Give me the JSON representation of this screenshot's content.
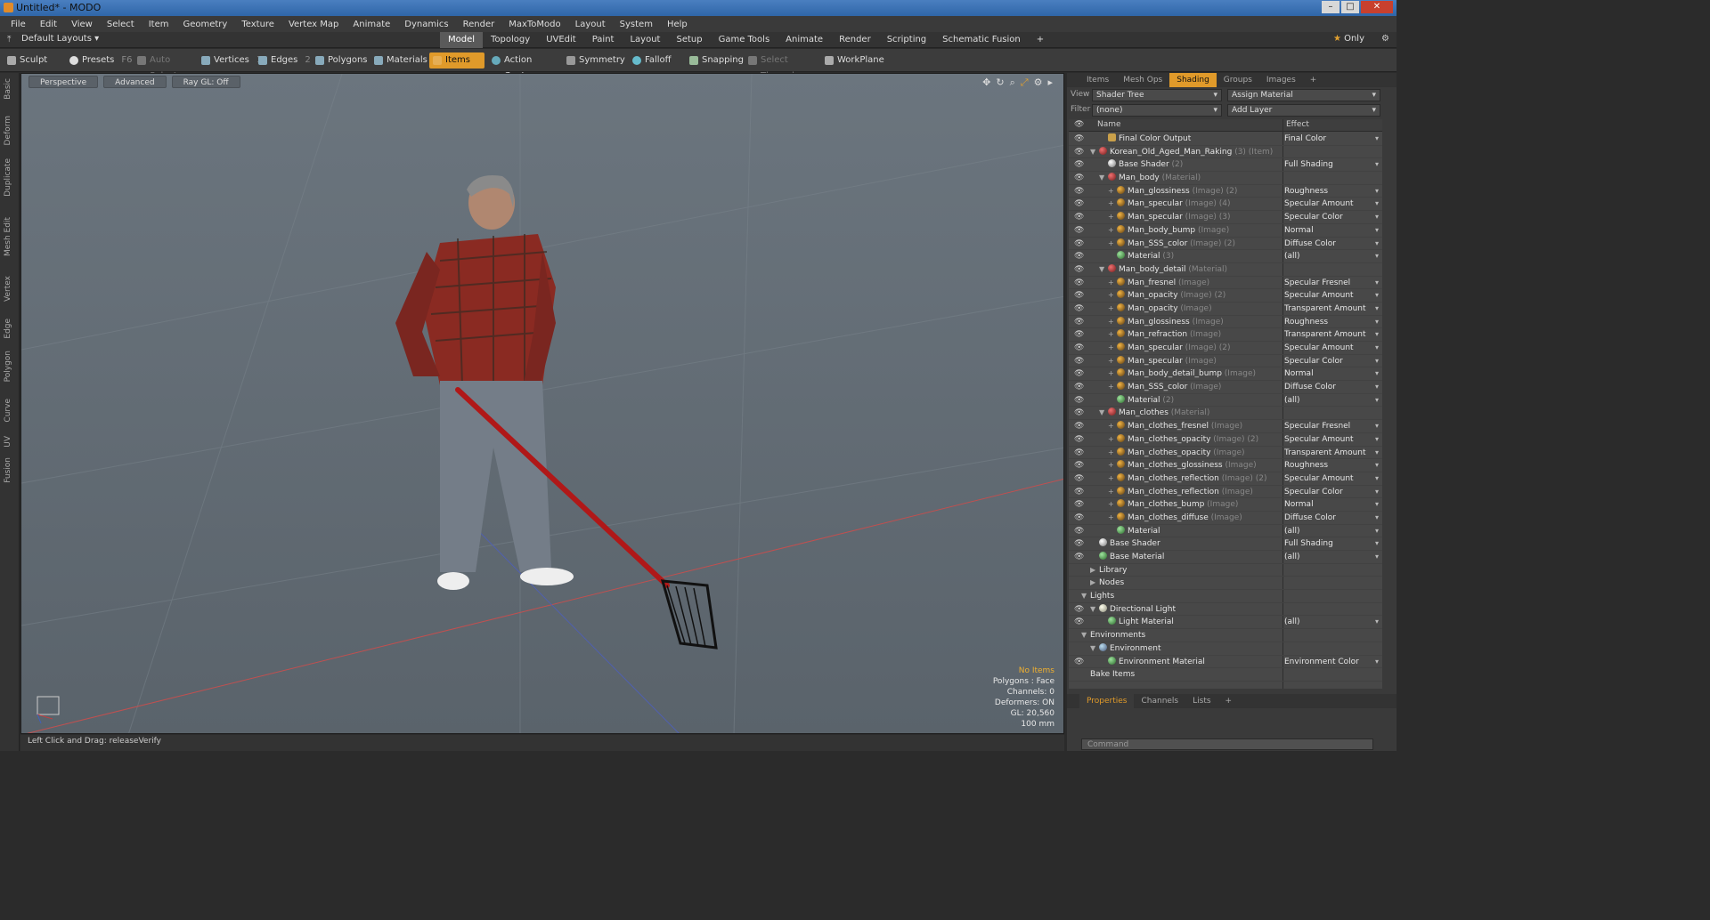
{
  "window": {
    "title": "Untitled* - MODO"
  },
  "menu": [
    "File",
    "Edit",
    "View",
    "Select",
    "Item",
    "Geometry",
    "Texture",
    "Vertex Map",
    "Animate",
    "Dynamics",
    "Render",
    "MaxToModo",
    "Layout",
    "System",
    "Help"
  ],
  "layoutbar": {
    "layouts": "Default Layouts ▾",
    "tabs": [
      "Model",
      "Topology",
      "UVEdit",
      "Paint",
      "Layout",
      "Setup",
      "Game Tools",
      "Animate",
      "Render",
      "Scripting",
      "Schematic Fusion",
      "+"
    ],
    "active_tab": "Model",
    "only": "Only"
  },
  "toolbar": {
    "sculpt": "Sculpt",
    "presets": "Presets",
    "presets_key": "F6",
    "auto_select": "Auto Select",
    "vertices": "Vertices",
    "vertices_key": "1",
    "edges": "Edges",
    "edges_key": "2",
    "polygons": "Polygons",
    "materials": "Materials",
    "items": "Items",
    "action_center": "Action Center",
    "symmetry": "Symmetry",
    "falloff": "Falloff",
    "snapping": "Snapping",
    "select_through": "Select Through",
    "workplane": "WorkPlane"
  },
  "left_strip": [
    "Basic",
    "Deform",
    "Duplicate",
    "Mesh Edit",
    "Vertex",
    "Edge",
    "Polygon",
    "Curve",
    "UV",
    "Fusion"
  ],
  "viewport": {
    "view": "Perspective",
    "mode": "Advanced",
    "raygl": "Ray GL: Off",
    "stats": {
      "no_items": "No Items",
      "polygons": "Polygons : Face",
      "channels": "Channels: 0",
      "deformers": "Deformers: ON",
      "gl": "GL: 20,560",
      "size": "100 mm"
    }
  },
  "status": {
    "text": "Left Click and Drag:  releaseVerify"
  },
  "right_panel": {
    "tabs": [
      "Items",
      "Mesh Ops",
      "Shading",
      "Groups",
      "Images",
      "+"
    ],
    "active_tab": "Shading",
    "view_label": "View",
    "view_value": "Shader Tree",
    "assign_material": "Assign Material",
    "filter_label": "Filter",
    "filter_value": "(none)",
    "add_layer": "Add Layer",
    "col_name": "Name",
    "col_effect": "Effect",
    "rows": [
      {
        "indent": 3,
        "icon": "out",
        "name": "Final Color Output",
        "type": "",
        "effect": "Final Color",
        "eye": true,
        "expand": ""
      },
      {
        "indent": 2,
        "icon": "grp",
        "name": "Korean_Old_Aged_Man_Raking",
        "type": "(3) (Item)",
        "effect": "",
        "eye": true,
        "expand": "▼"
      },
      {
        "indent": 3,
        "icon": "sh",
        "name": "Base Shader",
        "type": "(2)",
        "effect": "Full Shading",
        "eye": true,
        "expand": ""
      },
      {
        "indent": 3,
        "icon": "grp",
        "name": "Man_body",
        "type": "(Material)",
        "effect": "",
        "eye": true,
        "expand": "▼"
      },
      {
        "indent": 4,
        "icon": "img",
        "name": "Man_glossiness",
        "type": "(Image) (2)",
        "effect": "Roughness",
        "eye": true,
        "expand": "+"
      },
      {
        "indent": 4,
        "icon": "img",
        "name": "Man_specular",
        "type": "(Image) (4)",
        "effect": "Specular Amount",
        "eye": true,
        "expand": "+"
      },
      {
        "indent": 4,
        "icon": "img",
        "name": "Man_specular",
        "type": "(Image) (3)",
        "effect": "Specular Color",
        "eye": true,
        "expand": "+"
      },
      {
        "indent": 4,
        "icon": "img",
        "name": "Man_body_bump",
        "type": "(Image)",
        "effect": "Normal",
        "eye": true,
        "expand": "+"
      },
      {
        "indent": 4,
        "icon": "img",
        "name": "Man_SSS_color",
        "type": "(Image) (2)",
        "effect": "Diffuse Color",
        "eye": true,
        "expand": "+"
      },
      {
        "indent": 4,
        "icon": "mat",
        "name": "Material",
        "type": "(3)",
        "effect": "(all)",
        "eye": true,
        "expand": ""
      },
      {
        "indent": 3,
        "icon": "grp",
        "name": "Man_body_detail",
        "type": "(Material)",
        "effect": "",
        "eye": true,
        "expand": "▼"
      },
      {
        "indent": 4,
        "icon": "img",
        "name": "Man_fresnel",
        "type": "(Image)",
        "effect": "Specular Fresnel",
        "eye": true,
        "expand": "+"
      },
      {
        "indent": 4,
        "icon": "img",
        "name": "Man_opacity",
        "type": "(Image) (2)",
        "effect": "Specular Amount",
        "eye": true,
        "expand": "+"
      },
      {
        "indent": 4,
        "icon": "img",
        "name": "Man_opacity",
        "type": "(Image)",
        "effect": "Transparent Amount",
        "eye": true,
        "expand": "+"
      },
      {
        "indent": 4,
        "icon": "img",
        "name": "Man_glossiness",
        "type": "(Image)",
        "effect": "Roughness",
        "eye": true,
        "expand": "+"
      },
      {
        "indent": 4,
        "icon": "img",
        "name": "Man_refraction",
        "type": "(Image)",
        "effect": "Transparent Amount",
        "eye": true,
        "expand": "+"
      },
      {
        "indent": 4,
        "icon": "img",
        "name": "Man_specular",
        "type": "(Image) (2)",
        "effect": "Specular Amount",
        "eye": true,
        "expand": "+"
      },
      {
        "indent": 4,
        "icon": "img",
        "name": "Man_specular",
        "type": "(Image)",
        "effect": "Specular Color",
        "eye": true,
        "expand": "+"
      },
      {
        "indent": 4,
        "icon": "img",
        "name": "Man_body_detail_bump",
        "type": "(Image)",
        "effect": "Normal",
        "eye": true,
        "expand": "+"
      },
      {
        "indent": 4,
        "icon": "img",
        "name": "Man_SSS_color",
        "type": "(Image)",
        "effect": "Diffuse Color",
        "eye": true,
        "expand": "+"
      },
      {
        "indent": 4,
        "icon": "mat",
        "name": "Material",
        "type": "(2)",
        "effect": "(all)",
        "eye": true,
        "expand": ""
      },
      {
        "indent": 3,
        "icon": "grp",
        "name": "Man_clothes",
        "type": "(Material)",
        "effect": "",
        "eye": true,
        "expand": "▼"
      },
      {
        "indent": 4,
        "icon": "img",
        "name": "Man_clothes_fresnel",
        "type": "(Image)",
        "effect": "Specular Fresnel",
        "eye": true,
        "expand": "+"
      },
      {
        "indent": 4,
        "icon": "img",
        "name": "Man_clothes_opacity",
        "type": "(Image) (2)",
        "effect": "Specular Amount",
        "eye": true,
        "expand": "+"
      },
      {
        "indent": 4,
        "icon": "img",
        "name": "Man_clothes_opacity",
        "type": "(Image)",
        "effect": "Transparent Amount",
        "eye": true,
        "expand": "+"
      },
      {
        "indent": 4,
        "icon": "img",
        "name": "Man_clothes_glossiness",
        "type": "(Image)",
        "effect": "Roughness",
        "eye": true,
        "expand": "+"
      },
      {
        "indent": 4,
        "icon": "img",
        "name": "Man_clothes_reflection",
        "type": "(Image) (2)",
        "effect": "Specular Amount",
        "eye": true,
        "expand": "+"
      },
      {
        "indent": 4,
        "icon": "img",
        "name": "Man_clothes_reflection",
        "type": "(Image)",
        "effect": "Specular Color",
        "eye": true,
        "expand": "+"
      },
      {
        "indent": 4,
        "icon": "img",
        "name": "Man_clothes_bump",
        "type": "(Image)",
        "effect": "Normal",
        "eye": true,
        "expand": "+"
      },
      {
        "indent": 4,
        "icon": "img",
        "name": "Man_clothes_diffuse",
        "type": "(Image)",
        "effect": "Diffuse Color",
        "eye": true,
        "expand": "+"
      },
      {
        "indent": 4,
        "icon": "mat",
        "name": "Material",
        "type": "",
        "effect": "(all)",
        "eye": true,
        "expand": ""
      },
      {
        "indent": 2,
        "icon": "sh",
        "name": "Base Shader",
        "type": "",
        "effect": "Full Shading",
        "eye": true,
        "expand": ""
      },
      {
        "indent": 2,
        "icon": "mat",
        "name": "Base Material",
        "type": "",
        "effect": "(all)",
        "eye": true,
        "expand": ""
      },
      {
        "indent": 2,
        "icon": "",
        "name": "Library",
        "type": "",
        "effect": "",
        "eye": false,
        "expand": "▶"
      },
      {
        "indent": 2,
        "icon": "",
        "name": "Nodes",
        "type": "",
        "effect": "",
        "eye": false,
        "expand": "▶"
      },
      {
        "indent": 1,
        "icon": "",
        "name": "Lights",
        "type": "",
        "effect": "",
        "eye": false,
        "expand": "▼"
      },
      {
        "indent": 2,
        "icon": "light",
        "name": "Directional Light",
        "type": "",
        "effect": "",
        "eye": true,
        "expand": "▼"
      },
      {
        "indent": 3,
        "icon": "mat",
        "name": "Light Material",
        "type": "",
        "effect": "(all)",
        "eye": true,
        "expand": ""
      },
      {
        "indent": 1,
        "icon": "",
        "name": "Environments",
        "type": "",
        "effect": "",
        "eye": false,
        "expand": "▼"
      },
      {
        "indent": 2,
        "icon": "env",
        "name": "Environment",
        "type": "",
        "effect": "",
        "eye": false,
        "expand": "▼"
      },
      {
        "indent": 3,
        "icon": "mat",
        "name": "Environment Material",
        "type": "",
        "effect": "Environment Color",
        "eye": true,
        "expand": ""
      },
      {
        "indent": 1,
        "icon": "",
        "name": "Bake Items",
        "type": "",
        "effect": "",
        "eye": false,
        "expand": ""
      }
    ],
    "prop_tabs": [
      "Properties",
      "Channels",
      "Lists",
      "+"
    ],
    "prop_active": "Properties",
    "command_placeholder": "Command"
  }
}
